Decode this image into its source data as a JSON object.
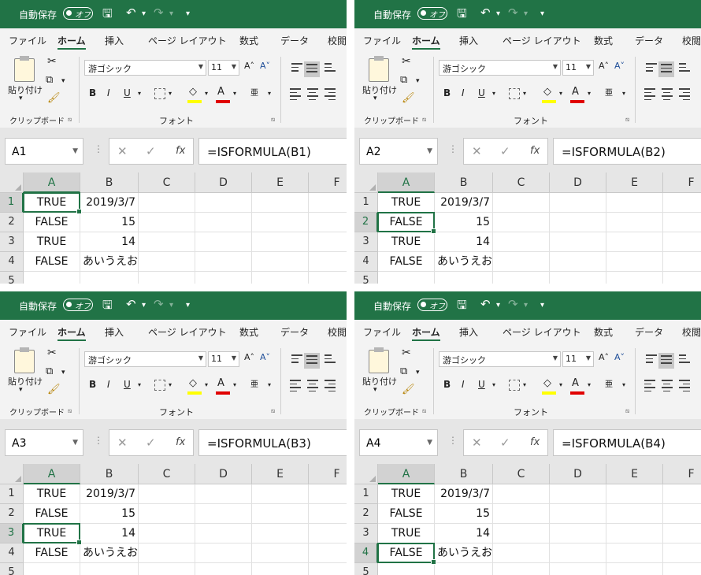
{
  "ribbon": {
    "autosave_label": "自動保存",
    "autosave_state": "オフ",
    "save_icon": "save-icon",
    "tabs": [
      "ファイル",
      "ホーム",
      "挿入",
      "ページ レイアウト",
      "数式",
      "データ",
      "校閲"
    ],
    "active_tab": "ホーム",
    "paste_label": "貼り付け",
    "clipboard_group": "クリップボード",
    "font_name": "游ゴシック",
    "font_size": "11",
    "font_group": "フォント",
    "bold": "B",
    "italic": "I",
    "underline": "U",
    "phonetic": "亜",
    "fill_color": "#ffff00",
    "font_color": "#e00000",
    "accent_color": "#217346"
  },
  "formula_bar": {
    "cancel_symbol": "✕",
    "enter_symbol": "✓",
    "fx_symbol": "fx"
  },
  "sheet": {
    "columns": [
      "A",
      "B",
      "C",
      "D",
      "E",
      "F"
    ],
    "rows": [
      "1",
      "2",
      "3",
      "4",
      "5"
    ],
    "cells": [
      [
        "TRUE",
        "2019/3/7"
      ],
      [
        "FALSE",
        "15"
      ],
      [
        "TRUE",
        "14"
      ],
      [
        "FALSE",
        "あいうえお"
      ],
      [
        "",
        ""
      ]
    ]
  },
  "panels": [
    {
      "name_box": "A1",
      "formula": "=ISFORMULA(B1)",
      "selected_row": 1
    },
    {
      "name_box": "A2",
      "formula": "=ISFORMULA(B2)",
      "selected_row": 2
    },
    {
      "name_box": "A3",
      "formula": "=ISFORMULA(B3)",
      "selected_row": 3
    },
    {
      "name_box": "A4",
      "formula": "=ISFORMULA(B4)",
      "selected_row": 4
    }
  ]
}
